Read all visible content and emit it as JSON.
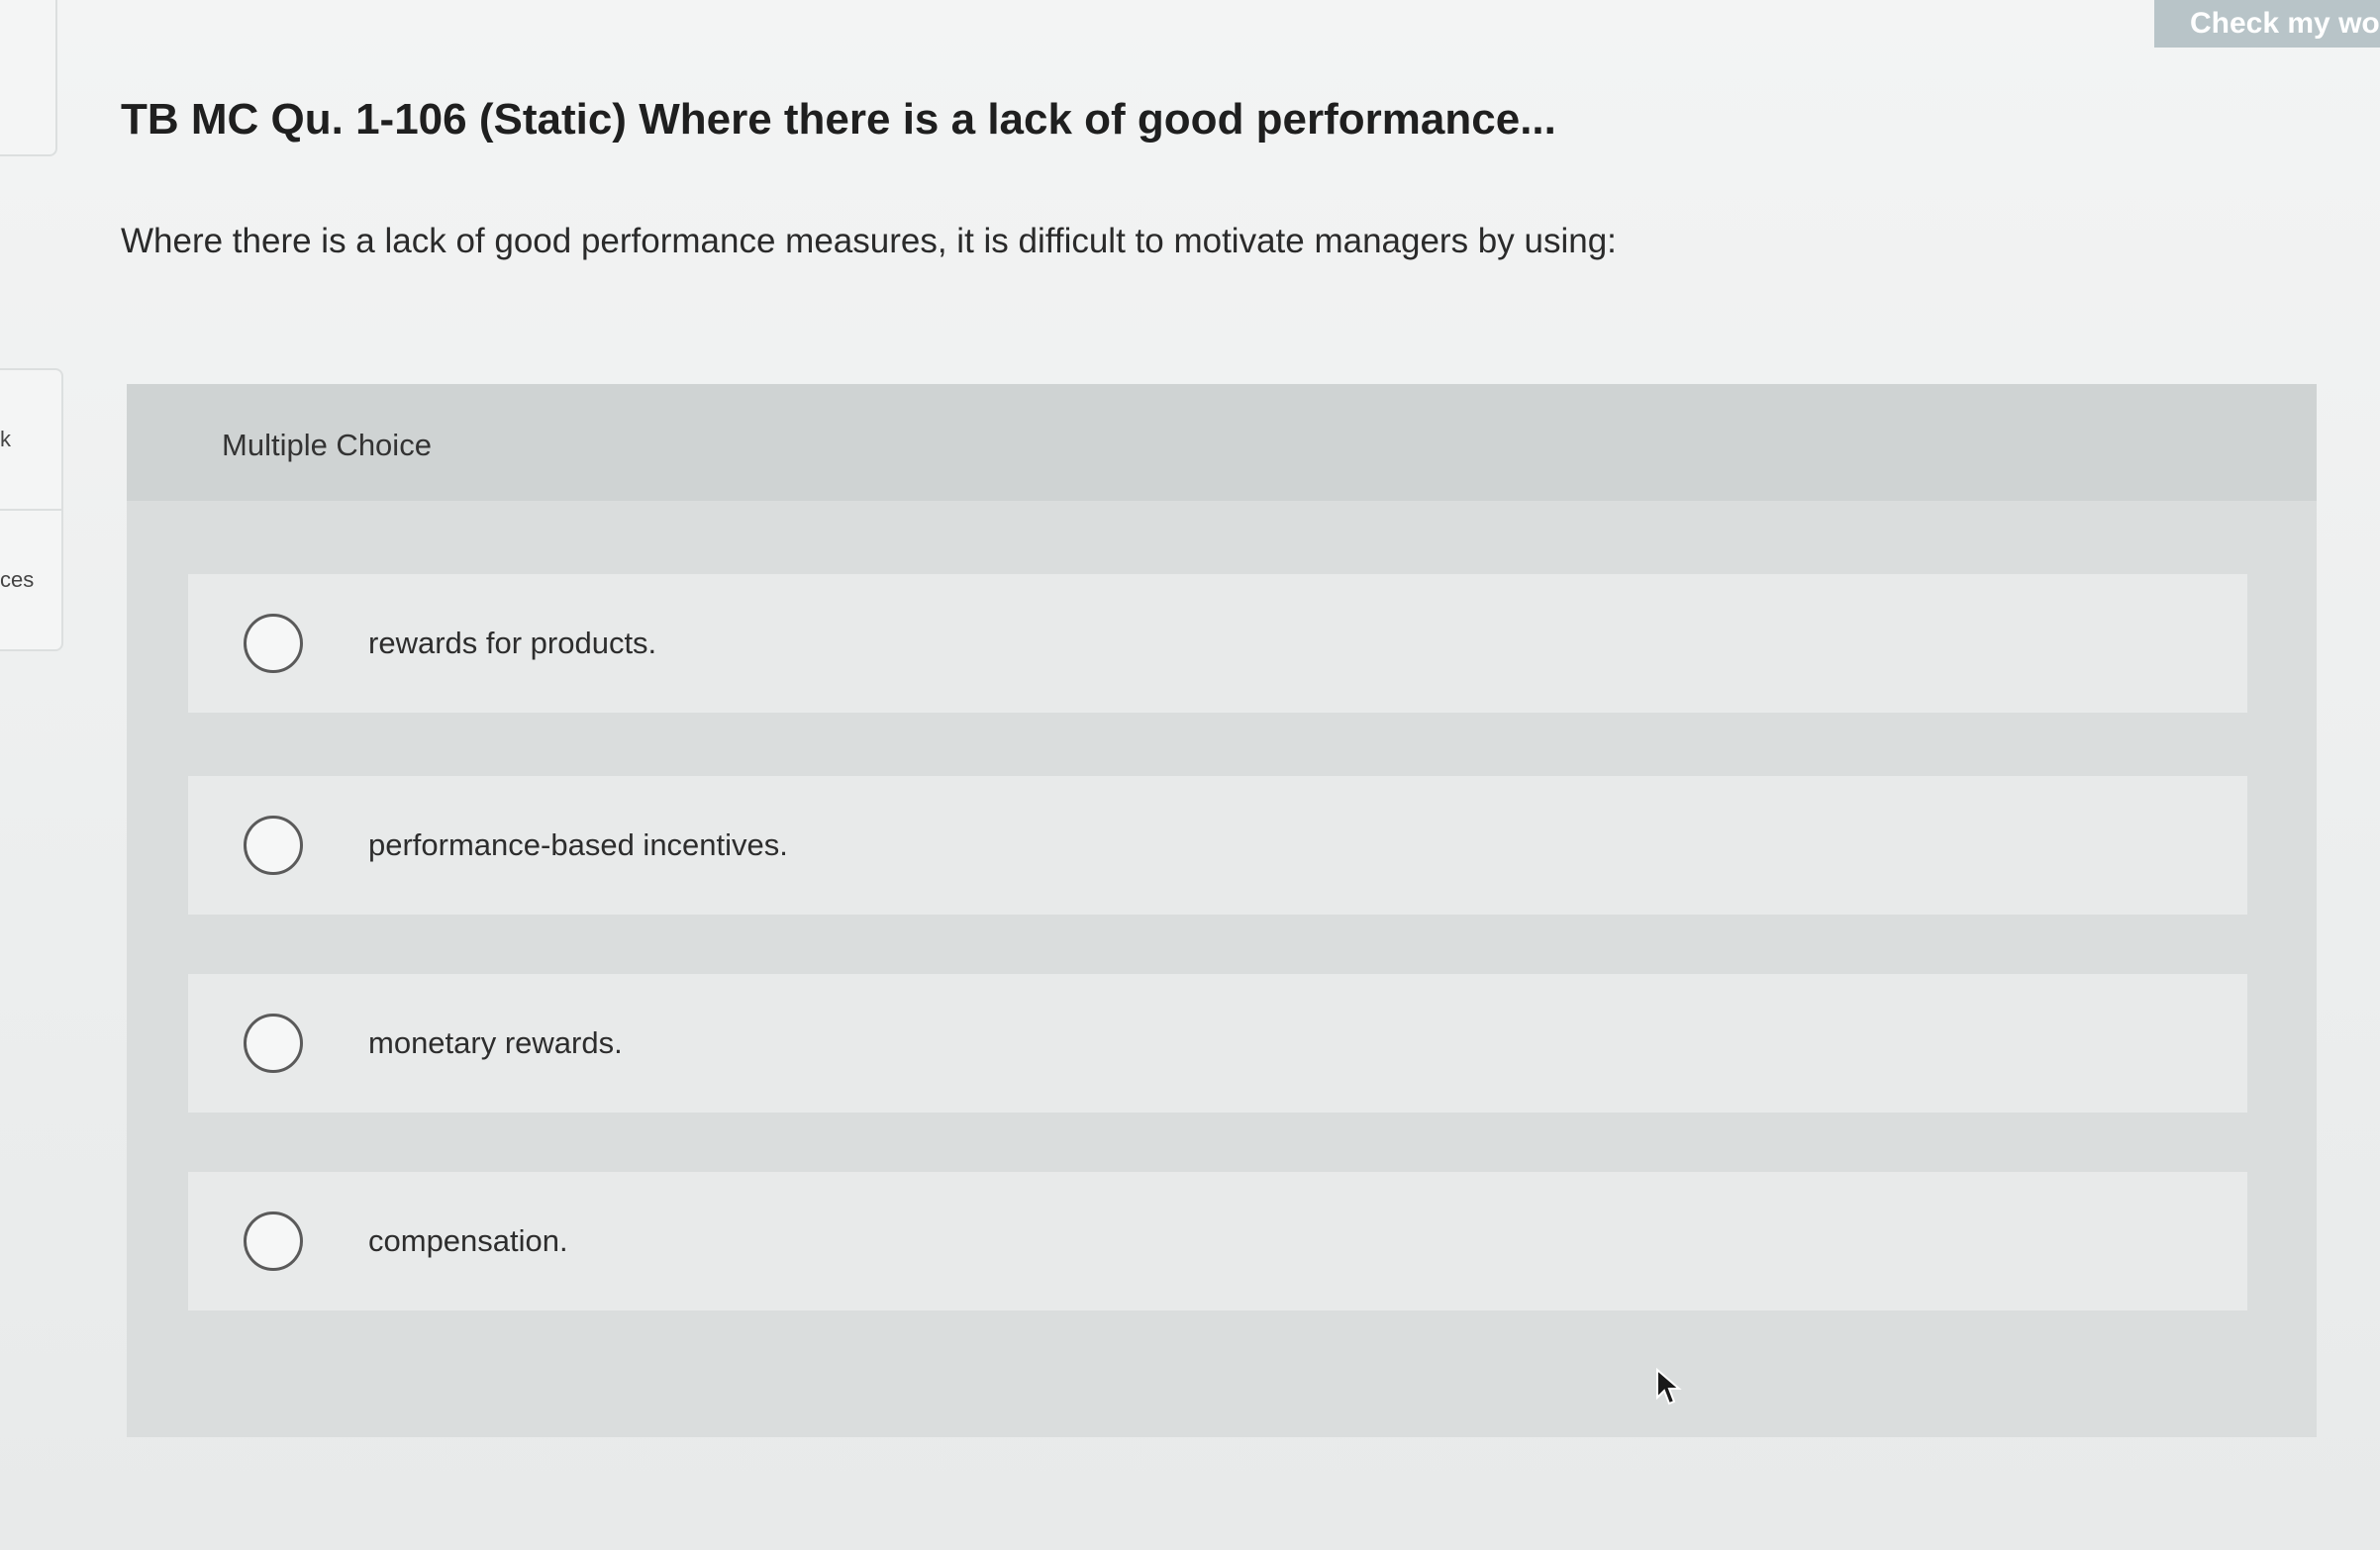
{
  "header": {
    "check_button_label": "Check my wo"
  },
  "left_rail": {
    "tab1_label": "k",
    "tab2_label": "ces"
  },
  "question": {
    "title": "TB MC Qu. 1-106 (Static) Where there is a lack of good performance...",
    "text": "Where there is a lack of good performance measures, it is difficult to motivate managers by using:"
  },
  "multiple_choice": {
    "label": "Multiple Choice",
    "options": [
      {
        "label": "rewards for products.",
        "selected": false
      },
      {
        "label": "performance-based incentives.",
        "selected": false
      },
      {
        "label": "monetary rewards.",
        "selected": false
      },
      {
        "label": "compensation.",
        "selected": false
      }
    ]
  },
  "colors": {
    "panel_bg": "#dadddd",
    "panel_header_bg": "#cfd3d3",
    "option_bg": "#e8eaea",
    "check_button_bg": "#b8c4c8"
  }
}
